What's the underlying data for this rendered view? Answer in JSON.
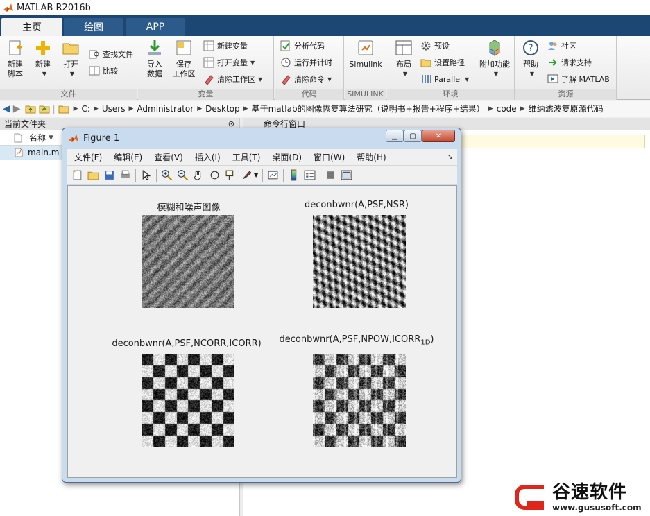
{
  "app": {
    "title": "MATLAB R2016b"
  },
  "tabs": [
    {
      "label": "主页"
    },
    {
      "label": "绘图"
    },
    {
      "label": "APP"
    }
  ],
  "ribbon": {
    "file": {
      "caption": "文件",
      "new_script": "新建\n脚本",
      "new": "新建",
      "open": "打开",
      "find_files": "查找文件",
      "compare": "比较"
    },
    "variable": {
      "caption": "变量",
      "import": "导入\n数据",
      "save_ws": "保存\n工作区",
      "new_var": "新建变量",
      "open_var": "打开变量",
      "clear_ws": "清除工作区"
    },
    "code": {
      "caption": "代码",
      "analyze": "分析代码",
      "run_time": "运行并计时",
      "clear_cmd": "清除命令"
    },
    "simulink": {
      "caption": "SIMULINK",
      "label": "Simulink"
    },
    "env": {
      "caption": "环境",
      "layout": "布局",
      "prefs": "预设",
      "set_path": "设置路径",
      "parallel": "Parallel",
      "addons": "附加功能"
    },
    "resources": {
      "caption": "资源",
      "help": "帮助",
      "community": "社区",
      "support": "请求支持",
      "learn": "了解 MATLAB"
    }
  },
  "address": {
    "segments": [
      "C:",
      "Users",
      "Administrator",
      "Desktop",
      "基于matlab的图像恢复算法研究（说明书+报告+程序+结果）",
      "code",
      "维纳滤波复原源代码"
    ]
  },
  "left_panel": {
    "title": "当前文件夹",
    "col_name": "名称",
    "files": [
      "main.m"
    ]
  },
  "cmd_panel": {
    "title": "命令行窗口"
  },
  "figure": {
    "title": "Figure 1",
    "menu": [
      "文件(F)",
      "编辑(E)",
      "查看(V)",
      "插入(I)",
      "工具(T)",
      "桌面(D)",
      "窗口(W)",
      "帮助(H)"
    ],
    "subplots": [
      {
        "title": "模糊和噪声图像"
      },
      {
        "title": "deconbwnr(A,PSF,NSR)"
      },
      {
        "title": "deconbwnr(A,PSF,NCORR,ICORR)"
      },
      {
        "title": "deconbwnr(A,PSF,NPOW,ICORR",
        "subscript": "1D",
        "close": ")"
      }
    ]
  },
  "watermark": {
    "name": "谷速软件",
    "url": "www.gususoft.com",
    "brand_color": "#e0251b"
  },
  "colors": {
    "tab_bar": "#1c4673",
    "tab_inactive": "#2c5a8b",
    "figure_frame": "#c9dcef"
  }
}
